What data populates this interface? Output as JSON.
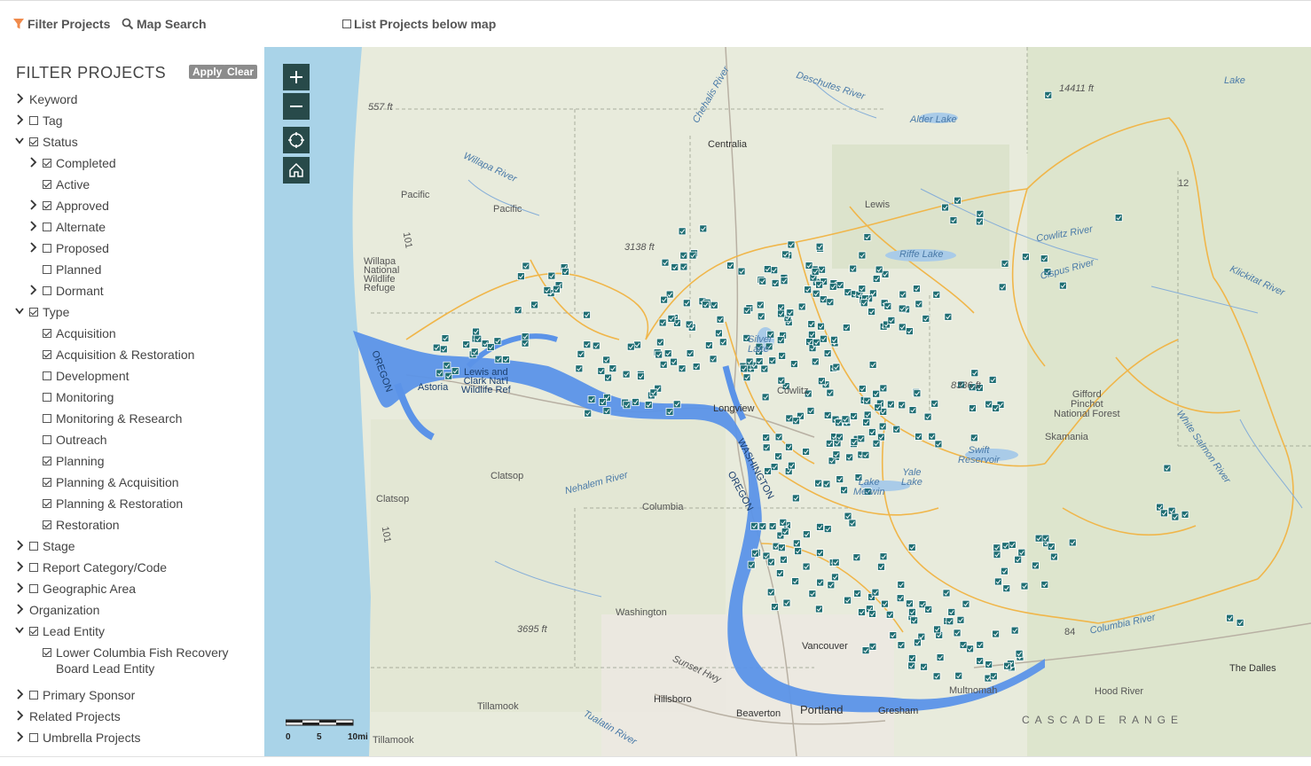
{
  "toolbar": {
    "filter_label": "Filter Projects",
    "search_label": "Map Search",
    "list_label": "List Projects below map"
  },
  "sidebar": {
    "title": "FILTER PROJECTS",
    "apply": "Apply",
    "clear": "Clear",
    "items": [
      {
        "label": "Keyword",
        "level": 0,
        "chevron": "right",
        "checkbox": null
      },
      {
        "label": "Tag",
        "level": 0,
        "chevron": "right",
        "checkbox": false
      },
      {
        "label": "Status",
        "level": 0,
        "chevron": "down",
        "checkbox": true
      },
      {
        "label": "Completed",
        "level": 1,
        "chevron": "right",
        "checkbox": true
      },
      {
        "label": "Active",
        "level": 1,
        "chevron": null,
        "checkbox": true
      },
      {
        "label": "Approved",
        "level": 1,
        "chevron": "right",
        "checkbox": true
      },
      {
        "label": "Alternate",
        "level": 1,
        "chevron": "right",
        "checkbox": false
      },
      {
        "label": "Proposed",
        "level": 1,
        "chevron": "right",
        "checkbox": false
      },
      {
        "label": "Planned",
        "level": 1,
        "chevron": null,
        "checkbox": false
      },
      {
        "label": "Dormant",
        "level": 1,
        "chevron": "right",
        "checkbox": false
      },
      {
        "label": "Type",
        "level": 0,
        "chevron": "down",
        "checkbox": true
      },
      {
        "label": "Acquisition",
        "level": 1,
        "chevron": null,
        "checkbox": true
      },
      {
        "label": "Acquisition & Restoration",
        "level": 1,
        "chevron": null,
        "checkbox": true
      },
      {
        "label": "Development",
        "level": 1,
        "chevron": null,
        "checkbox": false
      },
      {
        "label": "Monitoring",
        "level": 1,
        "chevron": null,
        "checkbox": false
      },
      {
        "label": "Monitoring & Research",
        "level": 1,
        "chevron": null,
        "checkbox": false
      },
      {
        "label": "Outreach",
        "level": 1,
        "chevron": null,
        "checkbox": false
      },
      {
        "label": "Planning",
        "level": 1,
        "chevron": null,
        "checkbox": true
      },
      {
        "label": "Planning & Acquisition",
        "level": 1,
        "chevron": null,
        "checkbox": true
      },
      {
        "label": "Planning & Restoration",
        "level": 1,
        "chevron": null,
        "checkbox": true
      },
      {
        "label": "Restoration",
        "level": 1,
        "chevron": null,
        "checkbox": true
      },
      {
        "label": "Stage",
        "level": 0,
        "chevron": "right",
        "checkbox": false
      },
      {
        "label": "Report Category/Code",
        "level": 0,
        "chevron": "right",
        "checkbox": false
      },
      {
        "label": "Geographic Area",
        "level": 0,
        "chevron": "right",
        "checkbox": false
      },
      {
        "label": "Organization",
        "level": 0,
        "chevron": "right",
        "checkbox": null
      },
      {
        "label": "Lead Entity",
        "level": 0,
        "chevron": "down",
        "checkbox": true
      },
      {
        "label": "Lower Columbia Fish Recovery\nBoard Lead Entity",
        "level": 1,
        "chevron": null,
        "checkbox": true,
        "tall": true
      },
      {
        "label": "Primary Sponsor",
        "level": 0,
        "chevron": "right",
        "checkbox": false
      },
      {
        "label": "Related Projects",
        "level": 0,
        "chevron": "right",
        "checkbox": null
      },
      {
        "label": "Umbrella Projects",
        "level": 0,
        "chevron": "right",
        "checkbox": false
      }
    ]
  },
  "map": {
    "controls": [
      "zoom-in",
      "zoom-out",
      "locate",
      "home"
    ],
    "labels": {
      "centralia": "Centralia",
      "lewis": "Lewis",
      "pacific1": "Pacific",
      "pacific2": "Pacific",
      "willapa": "Willapa\nNational\nWildlife\nRefuge",
      "astoria": "Astoria",
      "lewis_clark": "Lewis and\nClark Nat'l\nWildlife Ref",
      "oregon": "OREGON",
      "clatsop1": "Clatsop",
      "clatsop2": "Clatsop",
      "columbia": "Columbia",
      "washington": "Washington",
      "tillamook1": "Tillamook",
      "tillamook2": "Tillamook",
      "hillsboro": "Hillsboro",
      "beaverton": "Beaverton",
      "portland": "Portland",
      "gresham": "Gresham",
      "vancouver": "Vancouver",
      "multnomah": "Multnomah",
      "hoodriver": "Hood River",
      "thedalles": "The Dalles",
      "cascade": "CASCADE RANGE",
      "gifford": "Gifford\nPinchot\nNational Forest",
      "skamania": "Skamania",
      "swift": "Swift\nReservoir",
      "merwin": "Lake\nMerwin",
      "yale": "Yale\nLake",
      "riffe": "Riffe Lake",
      "alder": "Alder Lake",
      "silver": "Silver\nLake",
      "cowlitz": "Cowlitz",
      "longview": "Longview",
      "washington_state": "WASHINGTON",
      "oregon2": "OREGON",
      "deschutes": "Deschutes River",
      "chehalis": "Chehalis River",
      "willapa_river": "Willapa River",
      "nehalem": "Nehalem River",
      "cowlitz_river": "Cowlitz River",
      "cispus": "Cispus River",
      "klickitat": "Klickitat River",
      "white_salmon": "White Salmon River",
      "columbia_river": "Columbia River",
      "tualatin": "Tualatin River",
      "sunset": "Sunset Hwy",
      "lake": "Lake",
      "e557": "557 ft",
      "e3138": "3138 ft",
      "e14411": "14411 ft",
      "e8336": "8336 ft",
      "e3695": "3695 ft",
      "r101a": "101",
      "r101b": "101",
      "r12": "12",
      "r84": "84"
    },
    "scale": {
      "s0": "0",
      "s5": "5",
      "s10": "10mi"
    }
  },
  "colors": {
    "marker": "#1f6e73",
    "water": "#5b93e8",
    "boundary": "#f0b64a",
    "ctrl": "#284a4a"
  }
}
